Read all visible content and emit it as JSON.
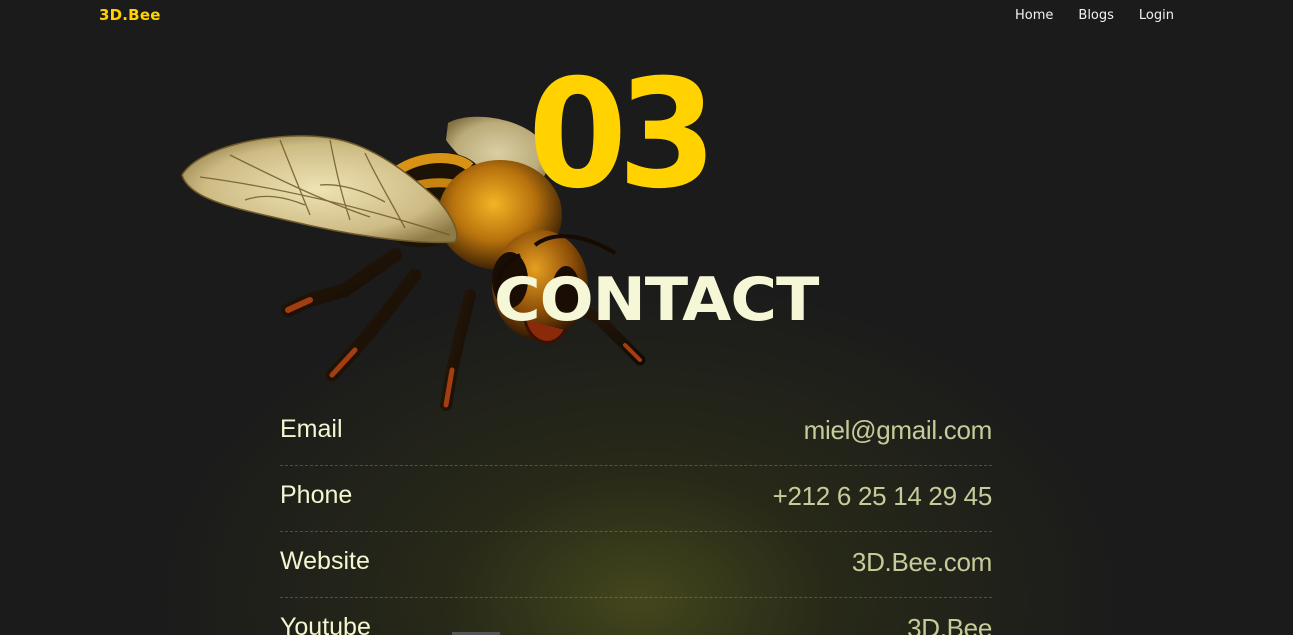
{
  "navbar": {
    "brand": "3D.Bee",
    "links": [
      {
        "label": "Home"
      },
      {
        "label": "Blogs"
      },
      {
        "label": "Login"
      }
    ]
  },
  "hero": {
    "number": "03",
    "title": "CONTACT"
  },
  "contact": {
    "rows": [
      {
        "label": "Email",
        "value": "miel@gmail.com"
      },
      {
        "label": "Phone",
        "value": "+212 6 25 14 29 45"
      },
      {
        "label": "Website",
        "value": "3D.Bee.com"
      },
      {
        "label": "Youtube",
        "value": "3D.Bee"
      }
    ]
  },
  "colors": {
    "accent": "#ffd200",
    "background": "#1b1b1b",
    "title": "#f6f7d6",
    "value": "#c7cb9a"
  }
}
